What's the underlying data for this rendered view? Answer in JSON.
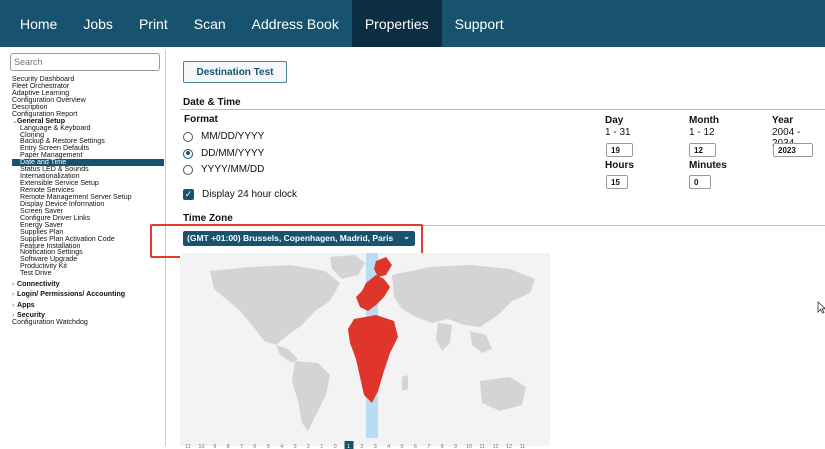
{
  "nav": {
    "items": [
      {
        "label": "Home"
      },
      {
        "label": "Jobs"
      },
      {
        "label": "Print"
      },
      {
        "label": "Scan"
      },
      {
        "label": "Address Book"
      },
      {
        "label": "Properties"
      },
      {
        "label": "Support"
      }
    ],
    "active": "Properties"
  },
  "sidebar": {
    "search_placeholder": "Search",
    "items_top": [
      "Security Dashboard",
      "Fleet Orchestrator",
      "Adaptive Learning",
      "Configuration Overview",
      "Description",
      "Configuration Report"
    ],
    "general_setup": "General Setup",
    "general_items": [
      "Language & Keyboard",
      "Cloning",
      "Backup & Restore Settings",
      "Entry Screen Defaults",
      "Paper Management",
      "Date and Time",
      "Status LED & Sounds",
      "Internationalization",
      "Extensible Service Setup",
      "Remote Services",
      "Remote Management Server Setup",
      "Display Device Information",
      "Screen Saver",
      "Configure Driver Links",
      "Energy Saver",
      "Supplies Plan",
      "Supplies Plan Activation Code",
      "Feature Installation",
      "Notification Settings",
      "Software Upgrade",
      "Productivity Kit",
      "Test Drive"
    ],
    "active_item": "Date and Time",
    "sections_bottom": [
      "Connectivity",
      "Login/ Permissions/ Accounting",
      "Apps",
      "Security"
    ],
    "last_item": "Configuration Watchdog"
  },
  "main": {
    "destination_test_label": "Destination Test",
    "date_time_heading": "Date & Time",
    "format_label": "Format",
    "format_options": [
      "MM/DD/YYYY",
      "DD/MM/YYYY",
      "YYYY/MM/DD"
    ],
    "format_selected": "DD/MM/YYYY",
    "display_24h_label": "Display 24 hour clock",
    "display_24h_checked": true,
    "day": {
      "label": "Day",
      "range": "1 - 31",
      "value": "19"
    },
    "month": {
      "label": "Month",
      "range": "1 - 12",
      "value": "12"
    },
    "year": {
      "label": "Year",
      "range": "2004 - 2034",
      "value": "2023"
    },
    "hours": {
      "label": "Hours",
      "value": "15"
    },
    "minutes": {
      "label": "Minutes",
      "value": "0"
    },
    "time_zone_heading": "Time Zone",
    "time_zone_value": "(GMT +01:00) Brussels, Copenhagen, Madrid, Paris",
    "offset_scale": [
      "11",
      "10",
      "9",
      "8",
      "7",
      "6",
      "5",
      "4",
      "3",
      "2",
      "1",
      "0",
      "1",
      "2",
      "3",
      "4",
      "5",
      "6",
      "7",
      "8",
      "9",
      "10",
      "11",
      "12",
      "12",
      "11"
    ],
    "offset_selected_index": 12
  },
  "colors": {
    "nav_bg": "#17536f",
    "nav_active": "#0c2e44",
    "highlight_red": "#e23a2b",
    "tz_band": "#b9dcf3",
    "selected_region": "#e0352b",
    "map_land": "#d4d4d4"
  }
}
